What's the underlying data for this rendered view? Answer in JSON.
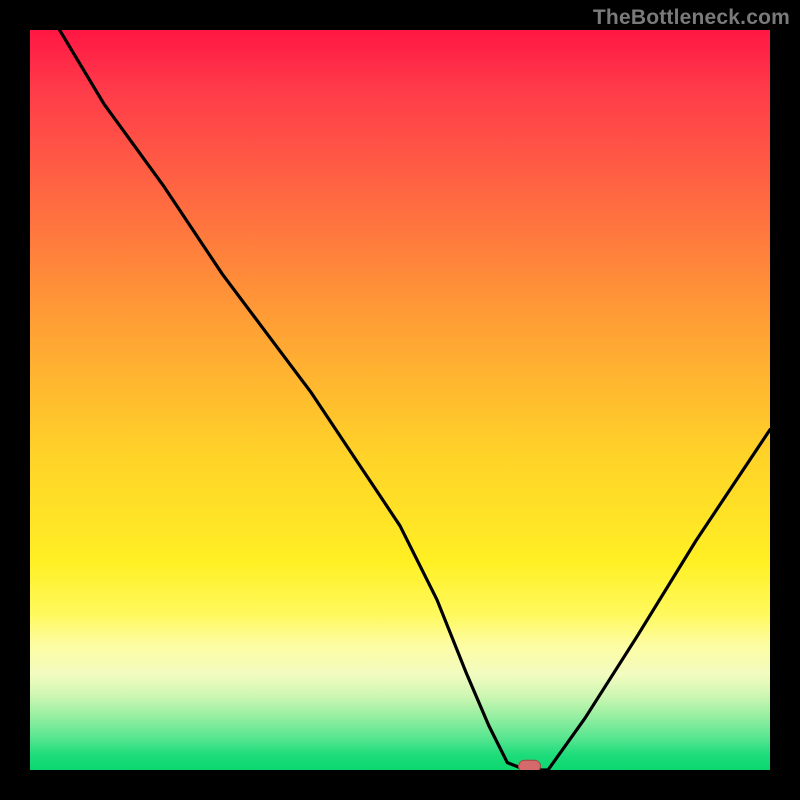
{
  "watermark": "TheBottleneck.com",
  "colors": {
    "frame": "#000000",
    "curve": "#000000",
    "marker_fill": "#d46a6a",
    "marker_stroke": "#a14848"
  },
  "chart_data": {
    "type": "line",
    "title": "",
    "xlabel": "",
    "ylabel": "",
    "xlim": [
      0,
      100
    ],
    "ylim": [
      0,
      100
    ],
    "grid": false,
    "legend": false,
    "series": [
      {
        "name": "bottleneck-curve",
        "x": [
          4,
          10,
          18,
          26,
          32,
          38,
          44,
          50,
          55,
          59,
          62,
          64.5,
          67,
          70,
          75,
          82,
          90,
          100
        ],
        "values": [
          100,
          90,
          79,
          67,
          59,
          51,
          42,
          33,
          23,
          13,
          6,
          1,
          0,
          0,
          7,
          18,
          31,
          46
        ]
      }
    ],
    "marker": {
      "x": 67.5,
      "y": 0.5,
      "shape": "pill"
    },
    "annotations": []
  }
}
